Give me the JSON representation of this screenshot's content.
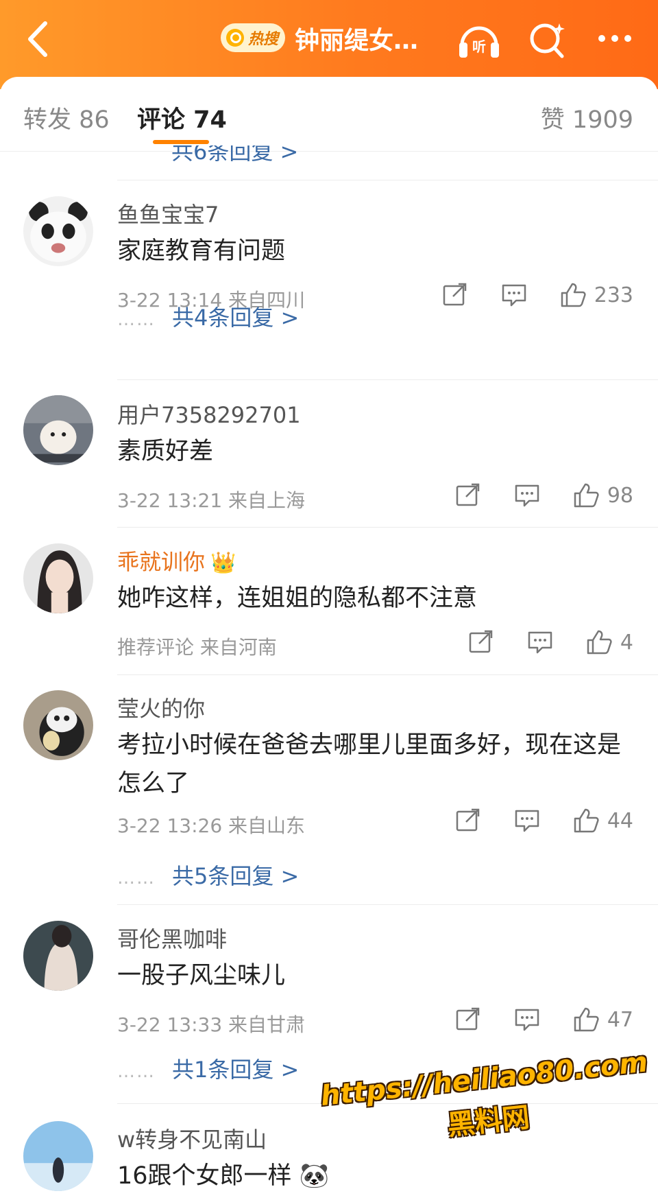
{
  "header": {
    "hot_label": "热搜",
    "title": "钟丽缇女…",
    "listen_label": "听"
  },
  "tabs": {
    "repost": "转发 86",
    "comments": "评论 74",
    "likes": "赞 1909"
  },
  "partial_reply_text": "共6条回复 >",
  "comments": [
    {
      "name": "鱼鱼宝宝7",
      "text": "家庭教育有问题",
      "meta": "3-22 13:14  来自四川",
      "likes": "233",
      "replies": "共4条回复 >"
    },
    {
      "name": "用户7358292701",
      "text": "素质好差",
      "meta": "3-22 13:21  来自上海",
      "likes": "98",
      "replies": ""
    },
    {
      "name": "乖就训你",
      "text": "她咋这样，连姐姐的隐私都不注意",
      "meta": "推荐评论  来自河南",
      "likes": "4",
      "replies": ""
    },
    {
      "name": "莹火的你",
      "text": "考拉小时候在爸爸去哪里儿里面多好，现在这是怎么了",
      "meta": "3-22 13:26  来自山东",
      "likes": "44",
      "replies": "共5条回复 >"
    },
    {
      "name": "哥伦黑咖啡",
      "text": "一股子风尘味儿",
      "meta": "3-22 13:33  来自甘肃",
      "likes": "47",
      "replies": "共1条回复 >"
    },
    {
      "name": "w转身不见南山",
      "text": "16跟个女郎一样",
      "meta": "",
      "likes": "",
      "replies": ""
    }
  ],
  "watermark": {
    "url": "https://heiliao80.com",
    "site": "黑料网"
  },
  "colors": {
    "header": "#ff7a1e",
    "accent": "#ff8200",
    "link": "#3a6aa6",
    "vip": "#e8731c"
  }
}
